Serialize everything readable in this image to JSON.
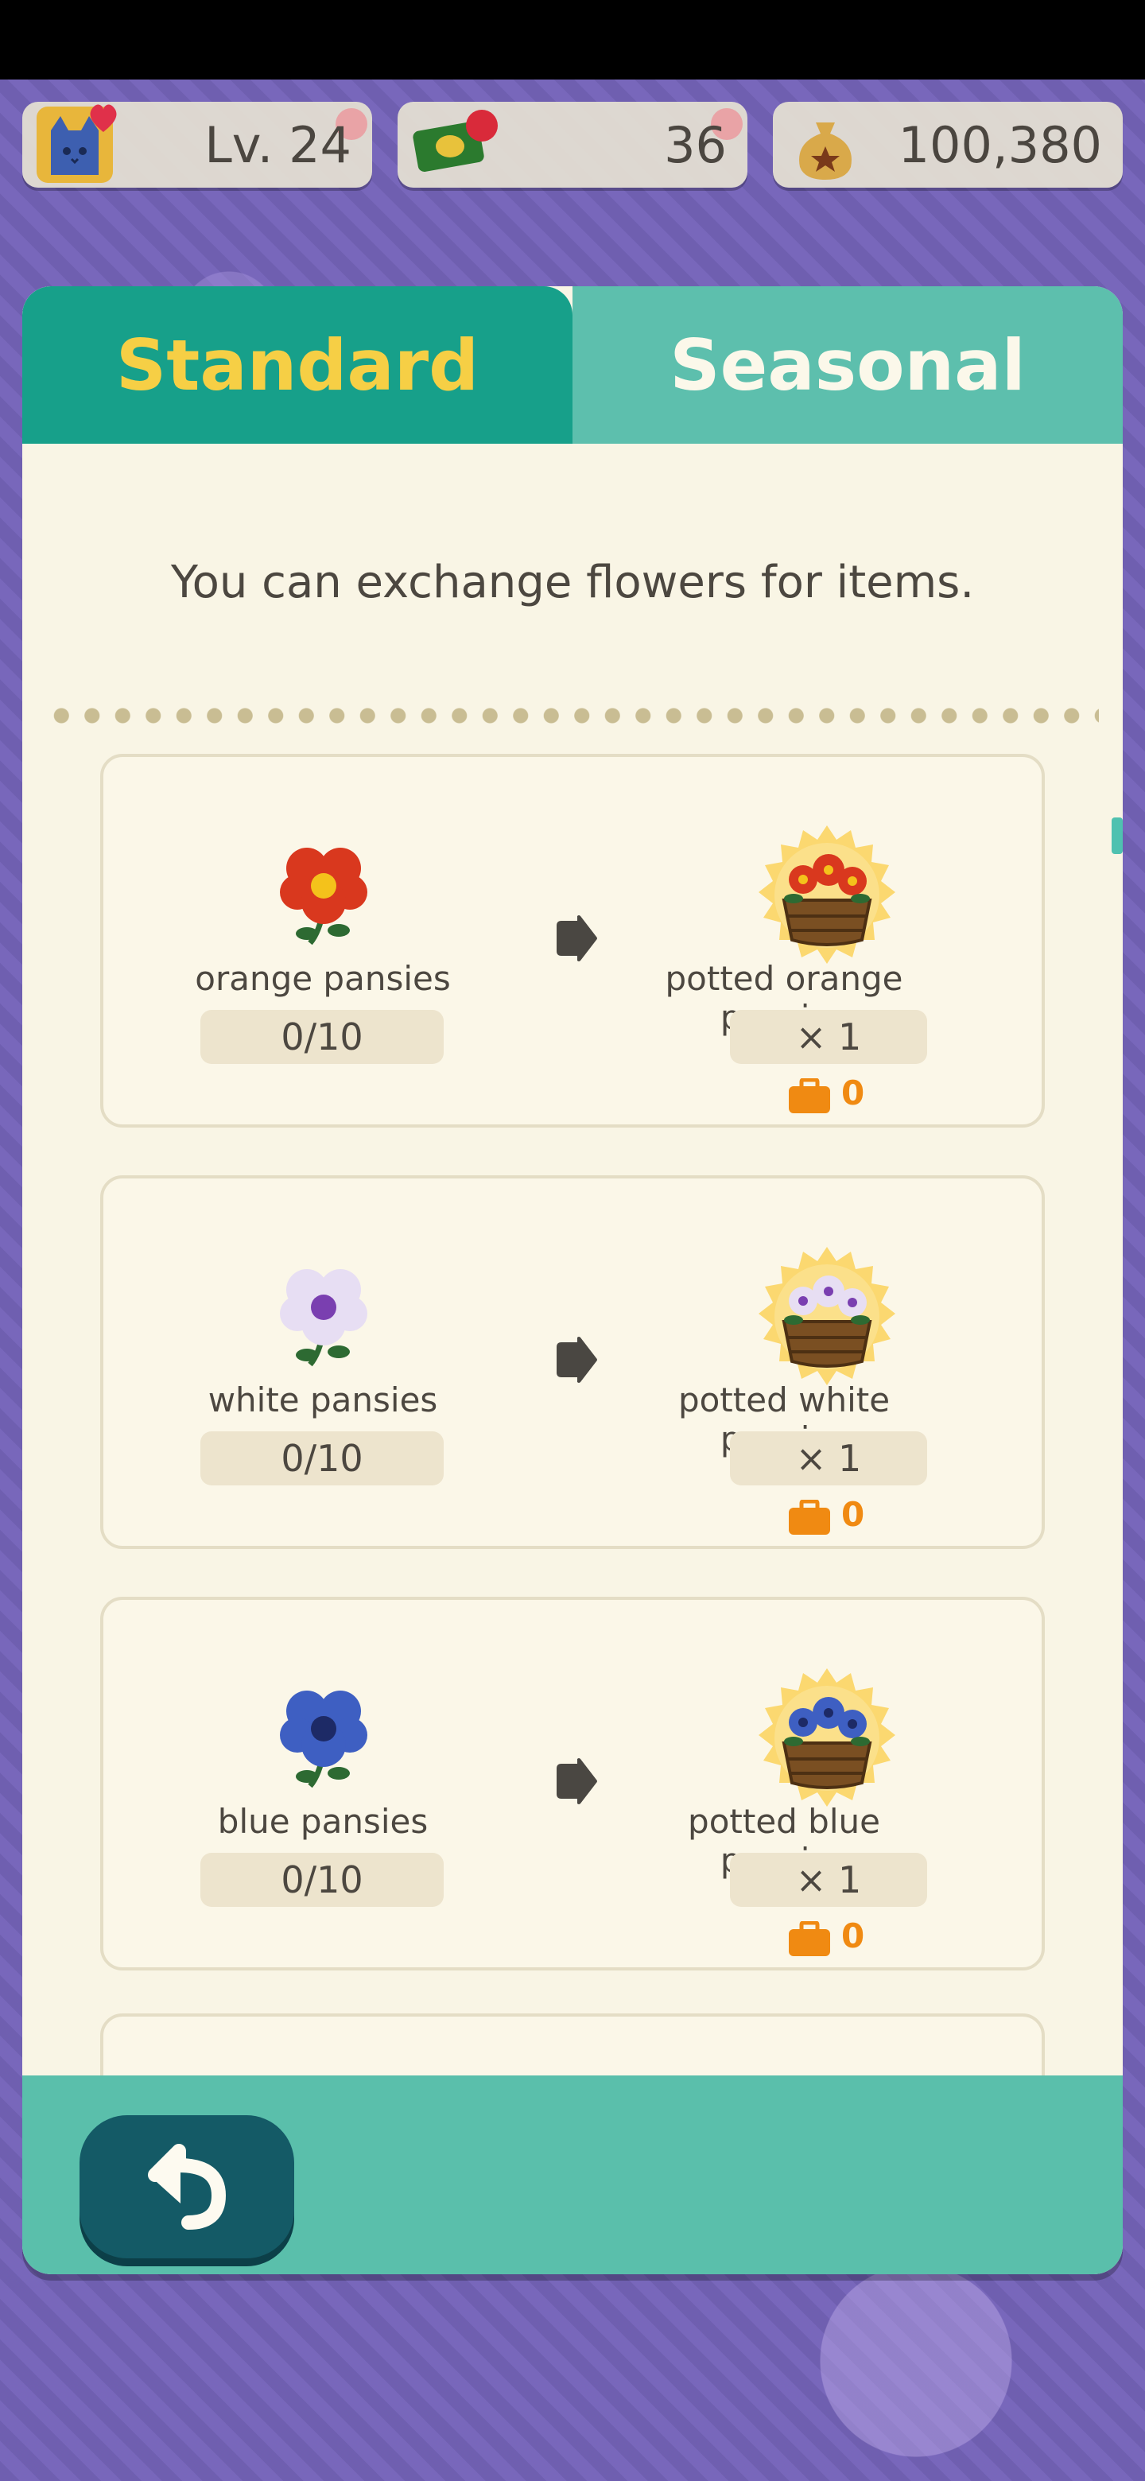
{
  "hud": {
    "level_text": "Lv. 24",
    "leaf_tickets": "36",
    "bells": "100,380"
  },
  "tabs": {
    "standard": "Standard",
    "seasonal": "Seasonal"
  },
  "intro_text": "You can exchange flowers for items.",
  "exchanges": [
    {
      "flower": "orange pansies",
      "progress": "0/10",
      "reward": "potted orange pansies",
      "quantity": "× 1",
      "owned": "0",
      "colors": {
        "petal": "#d9381e",
        "center": "#f4c21b"
      }
    },
    {
      "flower": "white pansies",
      "progress": "0/10",
      "reward": "potted white pansies",
      "quantity": "× 1",
      "owned": "0",
      "colors": {
        "petal": "#e7def3",
        "center": "#7a3fb0"
      }
    },
    {
      "flower": "blue pansies",
      "progress": "0/10",
      "reward": "potted blue pansies",
      "quantity": "× 1",
      "owned": "0",
      "colors": {
        "petal": "#3e5fc2",
        "center": "#1d2a66"
      }
    }
  ],
  "icons": {
    "back": "back-arrow-icon",
    "arrow": "arrow-right-icon",
    "bag": "bag-icon"
  },
  "theme": {
    "tab_active": "#17a08a",
    "tab_inactive": "#5dbfad",
    "tab_active_text": "#f6cf45",
    "accent_orange": "#f08a12"
  }
}
